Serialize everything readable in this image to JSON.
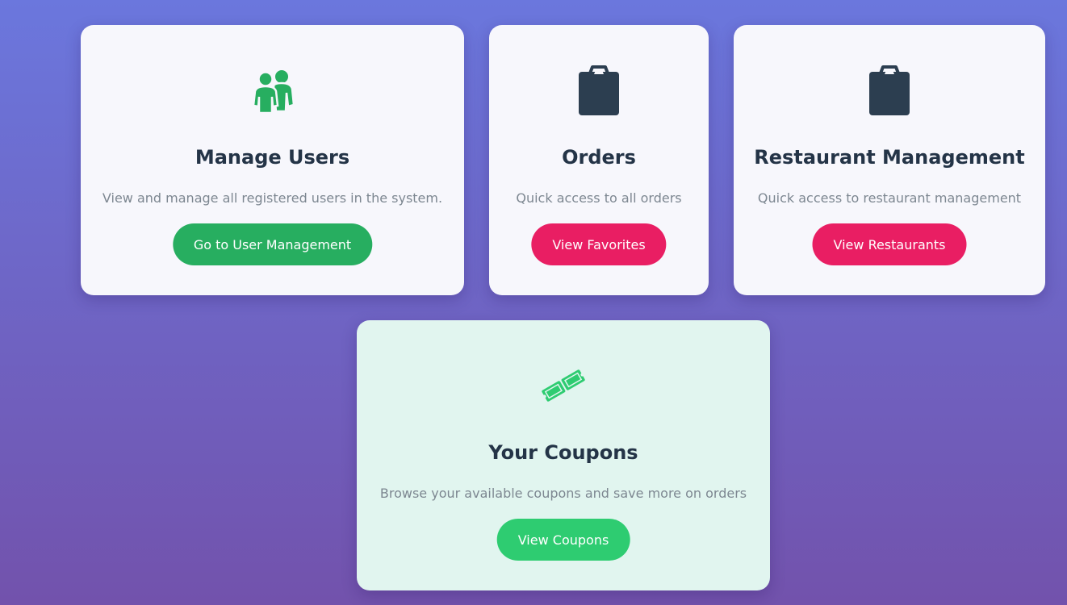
{
  "cards": [
    {
      "icon": "users-icon",
      "title": "Manage Users",
      "description": "View and manage all registered users in the system.",
      "button_label": "Go to User Management",
      "button_color": "#27ae60"
    },
    {
      "icon": "clipboard-icon",
      "title": "Orders",
      "description": "Quick access to all orders",
      "button_label": "View Favorites",
      "button_color": "#e91e63"
    },
    {
      "icon": "clipboard-icon",
      "title": "Restaurant Management",
      "description": "Quick access to restaurant management",
      "button_label": "View Restaurants",
      "button_color": "#e91e63"
    },
    {
      "icon": "tickets-icon",
      "title": "Your Coupons",
      "description": "Browse your available coupons and save more on orders",
      "button_label": "View Coupons",
      "button_color": "#2ecc71"
    }
  ],
  "colors": {
    "background_top": "#6b77dd",
    "background_bottom": "#7252ac",
    "card_background": "#f7f7fc",
    "coupon_card_background": "#e1f5ef",
    "title_text": "#243447",
    "description_text": "#7d8791",
    "users_icon": "#27ae60",
    "clipboard_icon": "#2c3e50",
    "tickets_icon": "#2ecc71"
  }
}
